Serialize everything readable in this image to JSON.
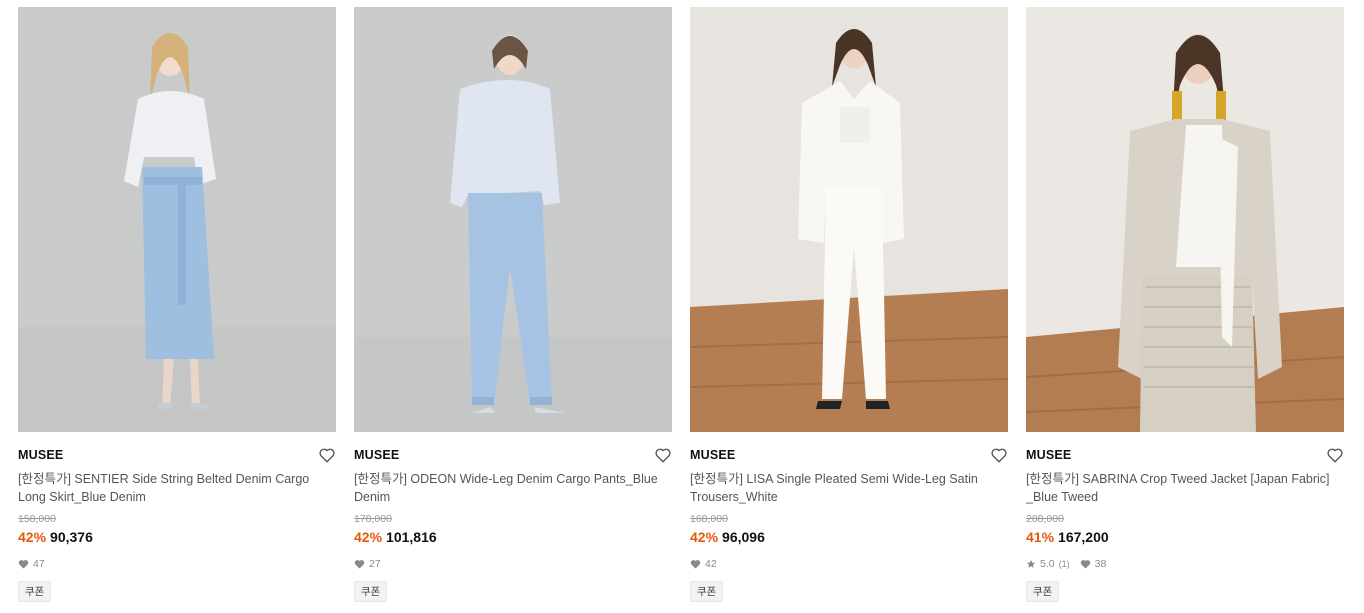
{
  "products": [
    {
      "brand": "MUSEE",
      "title": "[한정특가] SENTIER Side String Belted Denim Cargo Long Skirt_Blue Denim",
      "original_price": "158,000",
      "discount": "42%",
      "price": "90,376",
      "likes": "47",
      "rating": "",
      "reviews": "",
      "coupon": "쿠폰",
      "bg_color": "#c9cbcb"
    },
    {
      "brand": "MUSEE",
      "title": "[한정특가] ODEON Wide-Leg Denim Cargo Pants_Blue Denim",
      "original_price": "178,000",
      "discount": "42%",
      "price": "101,816",
      "likes": "27",
      "rating": "",
      "reviews": "",
      "coupon": "쿠폰",
      "bg_color": "#cacccc"
    },
    {
      "brand": "MUSEE",
      "title": "[한정특가] LISA Single Pleated Semi Wide-Leg Satin Trousers_White",
      "original_price": "168,000",
      "discount": "42%",
      "price": "96,096",
      "likes": "42",
      "rating": "",
      "reviews": "",
      "coupon": "쿠폰",
      "bg_color": "#e7e3de"
    },
    {
      "brand": "MUSEE",
      "title": "[한정특가] SABRINA Crop Tweed Jacket [Japan Fabric] _Blue Tweed",
      "original_price": "288,000",
      "discount": "41%",
      "price": "167,200",
      "likes": "38",
      "rating": "5.0",
      "reviews": "(1)",
      "coupon": "쿠폰",
      "bg_color": "#ebe8e4"
    }
  ],
  "colors": {
    "discount": "#e8590c",
    "heart": "#555555",
    "meta": "#888888"
  }
}
